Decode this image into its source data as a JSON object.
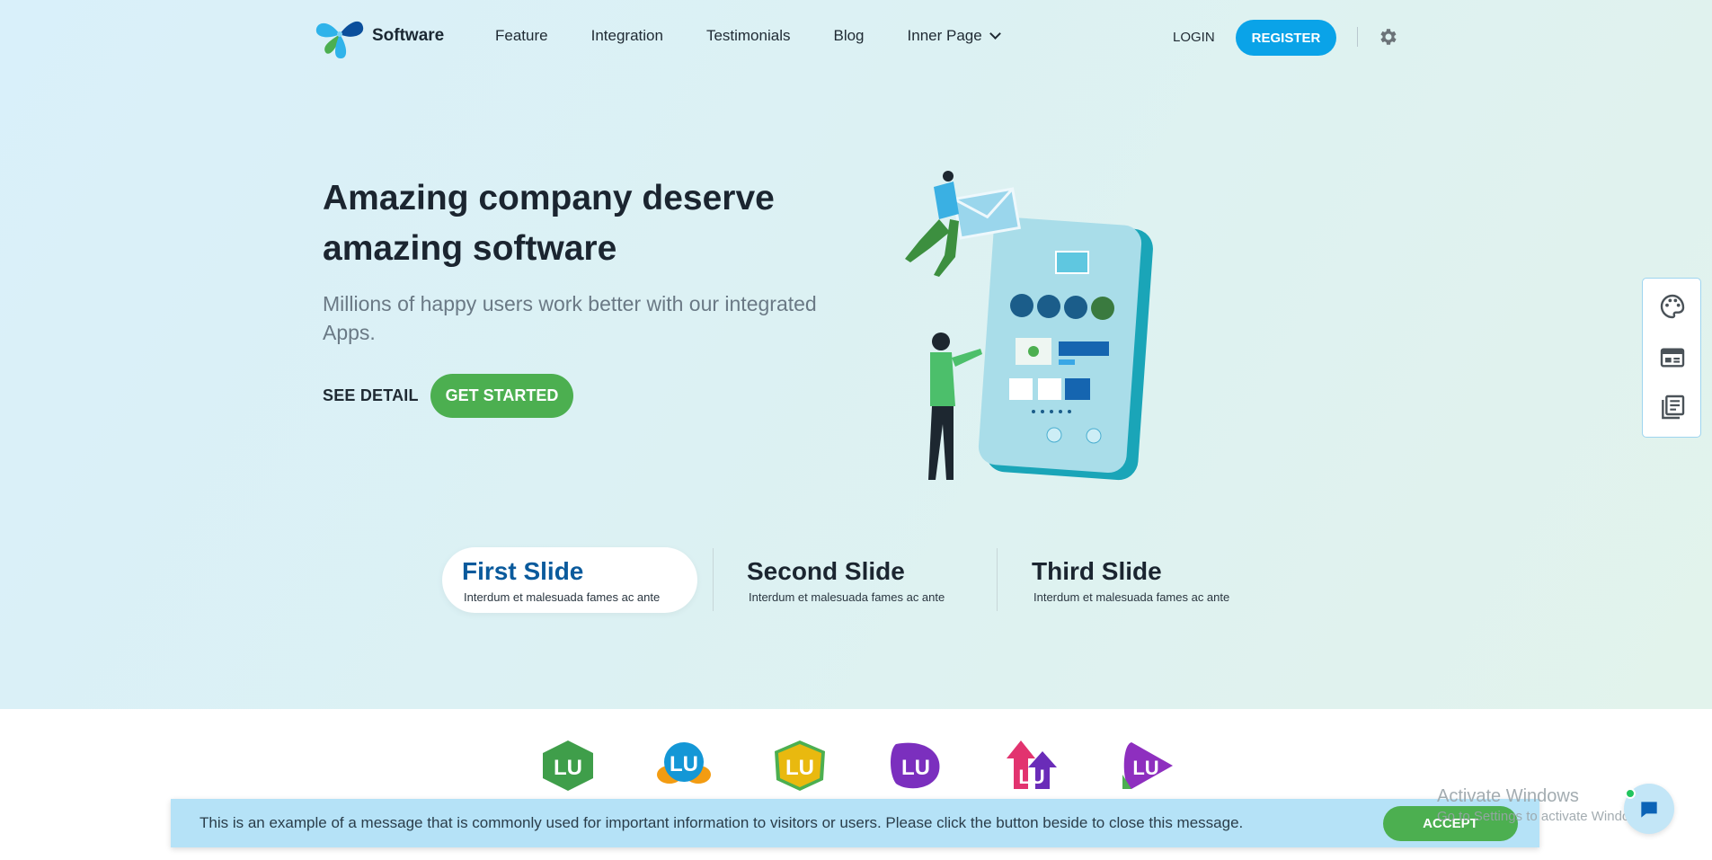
{
  "header": {
    "brand": "Software",
    "nav": [
      "Feature",
      "Integration",
      "Testimonials",
      "Blog",
      "Inner Page"
    ],
    "login": "LOGIN",
    "register": "REGISTER"
  },
  "hero": {
    "headline": "Amazing company deserve amazing software",
    "subline": "Millions of happy users work better with our integrated Apps.",
    "see_detail": "SEE DETAIL",
    "get_started": "GET STARTED"
  },
  "slides": [
    {
      "title": "First Slide",
      "desc": "Interdum et malesuada fames ac ante"
    },
    {
      "title": "Second Slide",
      "desc": "Interdum et malesuada fames ac ante"
    },
    {
      "title": "Third Slide",
      "desc": "Interdum et malesuada fames ac ante"
    }
  ],
  "brand_logo_text": "LU",
  "cookie": {
    "message": "This is an example of a message that is commonly used for important information to visitors or users. Please click the button beside to close this message.",
    "accept": "ACCEPT"
  },
  "watermark": {
    "line1": "Activate Windows",
    "line2": "Go to Settings to activate Windows."
  },
  "colors": {
    "primary_blue": "#0aa3e8",
    "green": "#4caf50",
    "active_slide_title": "#0a5a9c",
    "cookie_bg": "#b5e2f7"
  },
  "icons": [
    "settings-gear-icon",
    "palette-icon",
    "layout-icon",
    "document-list-icon",
    "chat-icon"
  ]
}
